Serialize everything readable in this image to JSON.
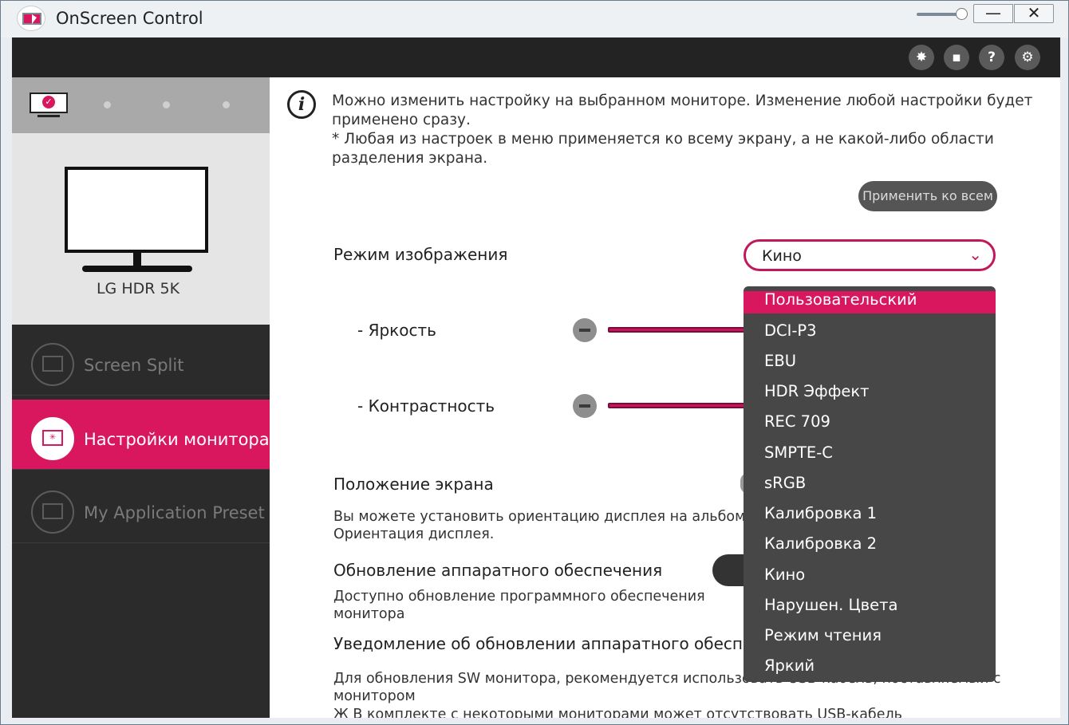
{
  "window": {
    "title": "OnScreen Control",
    "minimize_label": "—",
    "close_label": "✕"
  },
  "toolbar": {
    "buttons": [
      {
        "icon": "cursor-click-icon",
        "glyph": "✸"
      },
      {
        "icon": "screen-split-icon",
        "glyph": "▪"
      },
      {
        "icon": "help-icon",
        "glyph": "?"
      },
      {
        "icon": "gear-icon",
        "glyph": "⚙"
      }
    ]
  },
  "sidebar": {
    "monitor_name": "LG HDR 5K",
    "items": [
      {
        "label": "Screen Split",
        "active": false
      },
      {
        "label": "Настройки монитора",
        "active": true
      },
      {
        "label": "My Application Preset",
        "active": false
      }
    ]
  },
  "main": {
    "info_line1": "Можно изменить настройку на выбранном мониторе. Изменение любой настройки будет применено сразу.",
    "info_line2": "* Любая из настроек в меню применяется ко всему экрану, а не какой-либо области разделения экрана.",
    "apply_all": "Применить ко всем",
    "picture_mode_label": "Режим изображения",
    "picture_mode_value": "Кино",
    "brightness_label": "- Яркость",
    "contrast_label": "- Контрастность",
    "screen_position_label": "Положение экрана",
    "screen_position_desc": "Вы можете установить ориентацию дисплея на альбомн",
    "screen_position_desc2": "Ориентация дисплея.",
    "hw_update_label": "Обновление аппаратного обеспечения",
    "hw_update_desc": "Доступно обновление программного обеспечения монитора",
    "notify_label": "Уведомление об обновлении аппаратного обеспе",
    "notify_desc": "Для обновления SW монитора, рекомендуется использовать USB-кабель, поставляемый с монитором",
    "notify_desc2": "Ж В комплекте с некоторыми мониторами может отсутствовать USB-кабель"
  },
  "dropdown": {
    "options": [
      "Пользовательский",
      "DCI-P3",
      "EBU",
      "HDR Эффект",
      "REC 709",
      "SMPTE-C",
      "sRGB",
      "Калибровка 1",
      "Калибровка 2",
      "Кино",
      "Нарушен. Цвета",
      "Режим чтения",
      "Яркий"
    ],
    "highlighted": "Пользовательский"
  },
  "colors": {
    "accent": "#d8175f",
    "sidebar_bg": "#2b2b2b",
    "toolbar_bg": "#232323",
    "dropdown_bg": "#474747"
  }
}
